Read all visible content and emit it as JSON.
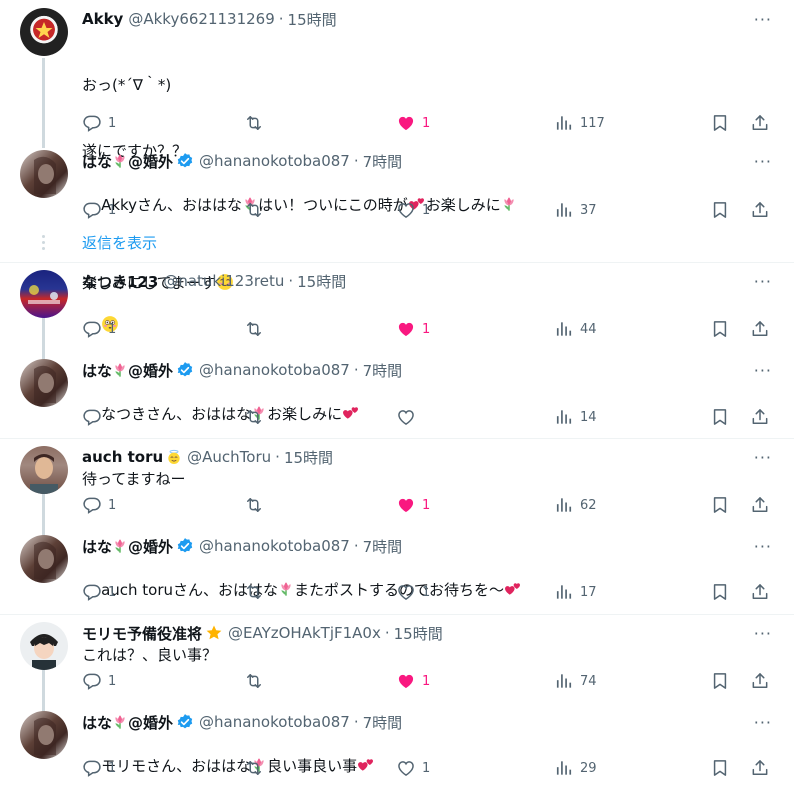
{
  "colors": {
    "accent": "#1d9bf0",
    "like": "#f91880",
    "muted": "#536471",
    "text": "#0f1419"
  },
  "icons": {
    "reply": "reply-icon",
    "repost": "repost-icon",
    "like": "heart-icon",
    "views": "views-icon",
    "bookmark": "bookmark-icon",
    "share": "share-icon",
    "more": "more-icon",
    "verified": "verified-badge-icon"
  },
  "more_label": "···",
  "show_replies": "返信を表示",
  "tweets": [
    {
      "name": "Akky",
      "handle": "@Akky6621131269",
      "sep": "·",
      "time": "15時間",
      "lines": [
        "おっ(*´∇｀*)",
        "遂にですか？？",
        "",
        "楽しみにしてまーす"
      ],
      "replies": "1",
      "reposts": "",
      "likes": "1",
      "liked": true,
      "views": "117"
    },
    {
      "name": "はな",
      "name_suffix": "@婚外",
      "handle": "@hananokotoba087",
      "sep": "·",
      "time": "7時間",
      "line_a": "Akkyさん、おははな",
      "line_b": "はい！ついにこの時が",
      "line_c": "お楽しみに",
      "replies": "1",
      "reposts": "",
      "likes": "1",
      "liked": false,
      "views": "37"
    },
    {
      "name": "なつき123",
      "handle": "@natuki123retu",
      "sep": "·",
      "time": "15時間",
      "replies": "1",
      "reposts": "",
      "likes": "1",
      "liked": true,
      "views": "44"
    },
    {
      "name": "はな",
      "name_suffix": "@婚外",
      "handle": "@hananokotoba087",
      "sep": "·",
      "time": "7時間",
      "line_a": "なつきさん、おははな",
      "line_b": "お楽しみに",
      "replies": "",
      "reposts": "",
      "likes": "",
      "liked": false,
      "views": "14"
    },
    {
      "name": "auch toru",
      "handle": "@AuchToru",
      "sep": "·",
      "time": "15時間",
      "text": "待ってますねー",
      "replies": "1",
      "reposts": "",
      "likes": "1",
      "liked": true,
      "views": "62"
    },
    {
      "name": "はな",
      "name_suffix": "@婚外",
      "handle": "@hananokotoba087",
      "sep": "·",
      "time": "7時間",
      "line_a": "auch toruさん、おははな",
      "line_b": "またポストするのでお待ちを〜",
      "replies": "1",
      "reposts": "",
      "likes": "1",
      "liked": false,
      "views": "17"
    },
    {
      "name": "モリモ予備役准将",
      "handle": "@EAYzOHAkTjF1A0x",
      "sep": "·",
      "time": "15時間",
      "text": "これは？、良い事？",
      "replies": "1",
      "reposts": "",
      "likes": "1",
      "liked": true,
      "views": "74"
    },
    {
      "name": "はな",
      "name_suffix": "@婚外",
      "handle": "@hananokotoba087",
      "sep": "·",
      "time": "7時間",
      "line_a": "モリモさん、おははな",
      "line_b": "良い事良い事",
      "replies": "1",
      "reposts": "",
      "likes": "1",
      "liked": false,
      "views": "29"
    }
  ]
}
